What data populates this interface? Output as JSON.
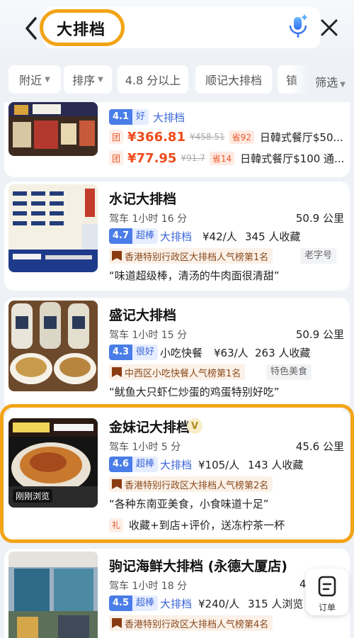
{
  "search": {
    "query": "大排档"
  },
  "filters": [
    {
      "label": "附近",
      "dropdown": true
    },
    {
      "label": "排序",
      "dropdown": true
    },
    {
      "label": "4.8 分以上",
      "dropdown": false
    },
    {
      "label": "顺记大排档",
      "dropdown": false
    },
    {
      "label": "镇",
      "dropdown": false
    }
  ],
  "filter_more_label": "筛选",
  "first": {
    "score": "4.1",
    "level": "好",
    "category": "大排档",
    "deals": [
      {
        "tag": "团",
        "price": "¥366.81",
        "orig": "¥458.51",
        "save": "省92",
        "name": "日韓式餐厅$50..."
      },
      {
        "tag": "团",
        "price": "¥77.95",
        "orig": "¥91.7",
        "save": "省14",
        "name": "日韓式餐厅$100 通..."
      }
    ]
  },
  "shui": {
    "name": "水记大排档",
    "drive": "驾车 1小时 16 分",
    "distance": "50.9 公里",
    "score": "4.7",
    "level": "超棒",
    "category": "大排档",
    "price": "¥42/人",
    "fav": "345 人收藏",
    "rank": "香港特别行政区大排档人气榜第1名",
    "tag": "老字号",
    "quote": "“味道超级棒，清汤的牛肉面很清甜”"
  },
  "sheng": {
    "name": "盛记大排档",
    "drive": "驾车 1小时 15 分",
    "distance": "50.9 公里",
    "score": "4.3",
    "level": "很好",
    "category": "小吃快餐",
    "price": "¥63/人",
    "fav": "263 人收藏",
    "rank": "中西区小吃快餐人气榜第1名",
    "tag": "特色美食",
    "quote": "“鱿鱼大只虾仁炒蛋的鸡蛋特别好吃”"
  },
  "jin": {
    "name": "金妹记大排档",
    "vip": "V",
    "drive": "驾车 1小时 5 分",
    "distance": "45.6 公里",
    "score": "4.6",
    "level": "超棒",
    "category": "大排档",
    "price": "¥105/人",
    "fav": "143 人收藏",
    "rank": "香港特别行政区大排档人气榜第2名",
    "quote": "“各种东南亚美食，小食味道十足”",
    "promo_tag": "礼",
    "promo": "收藏+到店+评价，送冻柠茶一杯",
    "photo_caption": "刚刚浏览"
  },
  "ju": {
    "name": "驹记海鲜大排档 (永德大厦店)",
    "drive": "驾车 1小时 18 分",
    "distance": "49",
    "score": "4.5",
    "level": "超棒",
    "category": "大排档",
    "price": "¥240/人",
    "fav": "315 人浏览",
    "rank": "香港特别行政区大排档人气榜第4名"
  },
  "order_label": "订单",
  "colors": {
    "accent": "#f2a417",
    "blue": "#4a7de8",
    "price": "#ee4b1b"
  },
  "icons": [
    "back-arrow-icon",
    "voice-mic-icon",
    "close-icon",
    "order-icon",
    "flag-icon"
  ]
}
